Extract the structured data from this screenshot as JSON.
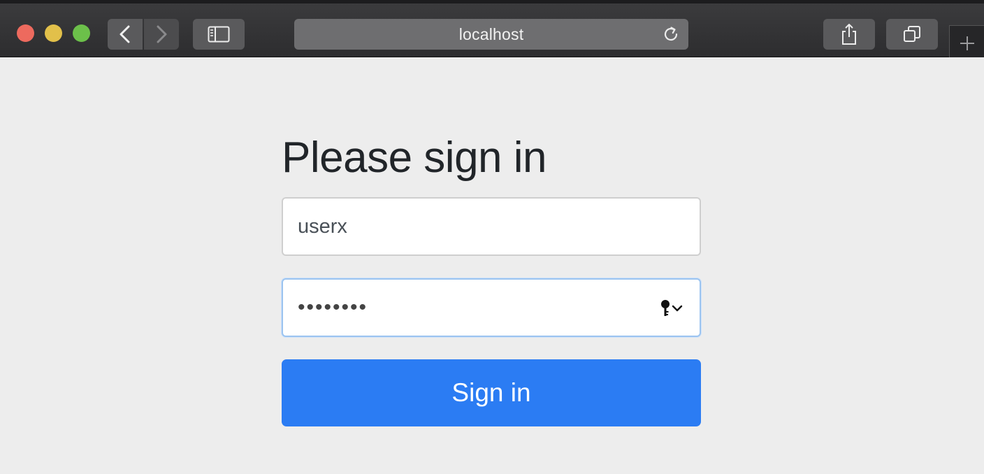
{
  "browser": {
    "address": "localhost"
  },
  "colors": {
    "accent": "#2b7cf3",
    "close": "#ed6a5e",
    "minimize": "#e2c04a",
    "maximize": "#6cc04a"
  },
  "login": {
    "heading": "Please sign in",
    "username_value": "userx",
    "password_mask": "••••••••",
    "submit_label": "Sign in"
  },
  "icons": {
    "back": "chevron-left-icon",
    "forward": "chevron-right-icon",
    "sidebar": "sidebar-icon",
    "reload": "reload-icon",
    "share": "share-icon",
    "tabs": "tabs-overview-icon",
    "new_tab": "plus-icon",
    "password_autofill": "key-icon"
  }
}
